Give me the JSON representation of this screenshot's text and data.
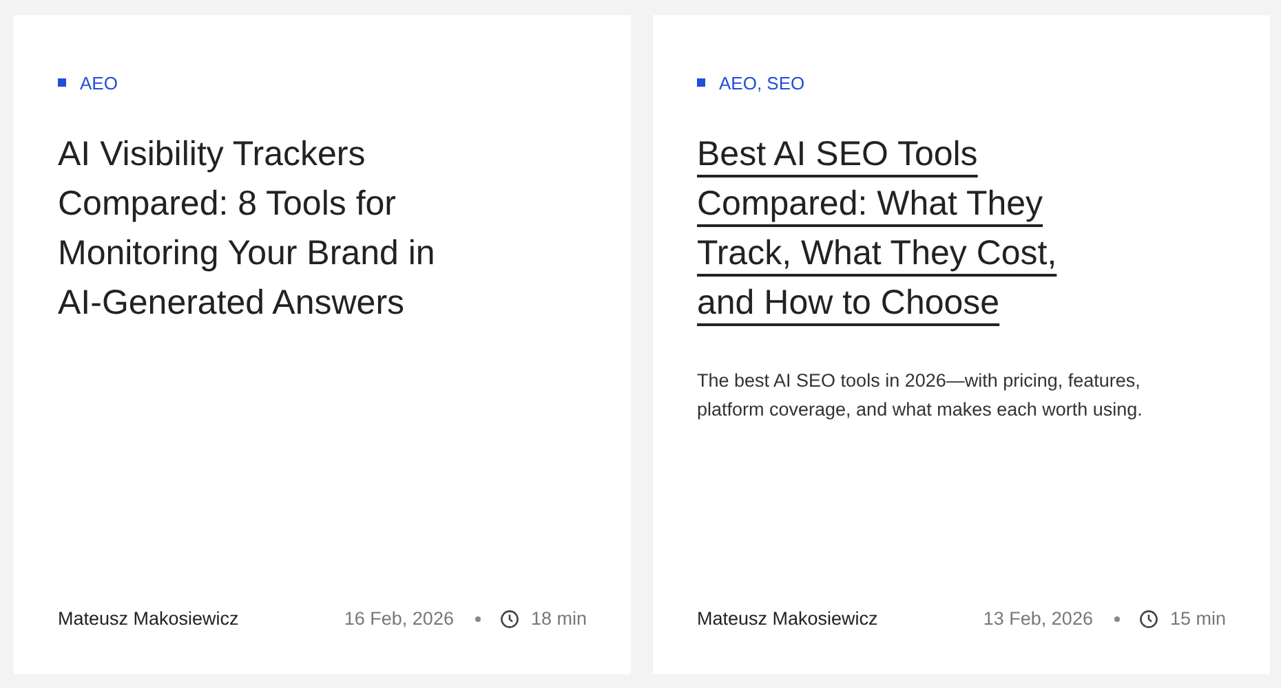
{
  "cards": [
    {
      "tag": "AEO",
      "title": "AI Visibility Trackers Compared: 8 Tools for Monitoring Your Brand in AI-Generated Answers",
      "hovered": false,
      "author": "Mateusz Makosiewicz",
      "date": "16 Feb, 2026",
      "read_time": "18 min"
    },
    {
      "tag": "AEO, SEO",
      "title": "Best AI SEO Tools Compared: What They Track, What They Cost, and How to Choose",
      "hovered": true,
      "description": "The best AI SEO tools in 2026—with pricing, features, platform coverage, and what makes each worth using.",
      "author": "Mateusz Makosiewicz",
      "date": "13 Feb, 2026",
      "read_time": "15 min"
    }
  ]
}
